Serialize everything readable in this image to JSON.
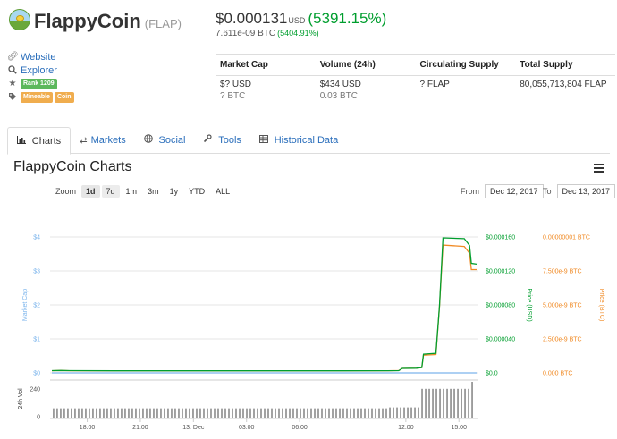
{
  "coin": {
    "name": "FlappyCoin",
    "symbol": "(FLAP)",
    "logo_icon": "flappy-bird-logo-icon"
  },
  "price": {
    "usd": "$0.000131",
    "usd_unit": "USD",
    "usd_change": "(5391.15%)",
    "btc": "7.611e-09 BTC",
    "btc_change": "(5404.91%)"
  },
  "links": {
    "website": "Website",
    "explorer": "Explorer",
    "rank": "Rank 1209",
    "tag_mineable": "Mineable",
    "tag_coin": "Coin"
  },
  "stats": {
    "headers": [
      "Market Cap",
      "Volume (24h)",
      "Circulating Supply",
      "Total Supply"
    ],
    "usd_row": [
      "$? USD",
      "$434 USD",
      "? FLAP",
      "80,055,713,804 FLAP"
    ],
    "btc_row": [
      "? BTC",
      "0.03 BTC",
      "",
      ""
    ]
  },
  "tabs": [
    {
      "label": "Charts",
      "icon": "bar-chart-icon"
    },
    {
      "label": "Markets",
      "icon": "exchange-icon"
    },
    {
      "label": "Social",
      "icon": "globe-icon"
    },
    {
      "label": "Tools",
      "icon": "wrench-icon"
    },
    {
      "label": "Historical Data",
      "icon": "table-icon"
    }
  ],
  "chart_header": {
    "title": "FlappyCoin Charts",
    "zoom_label": "Zoom",
    "zoom_buttons": [
      "1d",
      "7d",
      "1m",
      "3m",
      "1y",
      "YTD",
      "ALL"
    ],
    "selected_zoom": "1d",
    "from_label": "From",
    "from_date": "Dec 12, 2017",
    "to_label": "To",
    "to_date": "Dec 13, 2017"
  },
  "chart_data": {
    "type": "line",
    "colors": {
      "market_cap": "#7cb5ec",
      "price_usd": "#009e2e",
      "price_btc": "#f08a24",
      "volume": "#444444"
    },
    "x_ticks": [
      "18:00",
      "21:00",
      "13. Dec",
      "03:00",
      "06:00",
      "12:00",
      "15:00"
    ],
    "x_tick_hours": [
      18,
      21,
      24,
      27,
      30,
      36,
      39
    ],
    "x_range_hours": [
      15.9,
      40.1
    ],
    "market_cap_axis": {
      "label": "Market Cap",
      "ticks": [
        "$0",
        "$1",
        "$2",
        "$3",
        "$4"
      ],
      "range": [
        0,
        4
      ]
    },
    "price_usd_axis": {
      "label": "Price (USD)",
      "ticks": [
        "$0.0",
        "$0.000040",
        "$0.000080",
        "$0.000120",
        "$0.000160"
      ],
      "range": [
        0,
        0.00016
      ]
    },
    "price_btc_axis": {
      "label": "Price (BTC)",
      "ticks": [
        "0.000 BTC",
        "2.500e-9 BTC",
        "5.000e-9 BTC",
        "7.500e-9 BTC",
        "0.00000001 BTC"
      ],
      "range": [
        0,
        1e-08
      ]
    },
    "volume_axis": {
      "label": "24h Vol",
      "ticks": [
        "0",
        "240"
      ],
      "range": [
        0,
        300
      ]
    },
    "series": [
      {
        "name": "Price (USD)",
        "x": [
          16,
          16.5,
          17,
          20,
          24,
          28,
          32,
          35,
          35.6,
          35.8,
          36.6,
          36.9,
          37.0,
          37.7,
          37.9,
          38.1,
          39.3,
          39.6,
          39.7,
          40
        ],
        "values": [
          2.6e-06,
          2.8e-06,
          2.6e-06,
          2.4e-06,
          2.4e-06,
          2.4e-06,
          2.4e-06,
          2.5e-06,
          2.6e-06,
          5.3e-06,
          5.5e-06,
          6.3e-06,
          2.2e-05,
          2.3e-05,
          7.9e-05,
          0.000159,
          0.000158,
          0.00015,
          0.000129,
          0.000128
        ]
      },
      {
        "name": "Price (BTC)",
        "x": [
          16,
          16.5,
          17,
          20,
          24,
          28,
          32,
          35,
          35.6,
          35.8,
          36.6,
          36.9,
          37.0,
          37.7,
          37.9,
          38.1,
          39.3,
          39.6,
          39.7,
          40
        ],
        "values": [
          1.6e-10,
          1.8e-10,
          1.6e-10,
          1.5e-10,
          1.5e-10,
          1.5e-10,
          1.5e-10,
          1.6e-10,
          1.7e-10,
          3.3e-10,
          3.4e-10,
          3.9e-10,
          1.3e-09,
          1.35e-09,
          4.9e-09,
          9.4e-09,
          9.3e-09,
          8.8e-09,
          7.6e-09,
          7.6e-09
        ]
      },
      {
        "name": "Market Cap",
        "x": [
          16,
          40
        ],
        "values": [
          0,
          0
        ]
      }
    ],
    "volume": {
      "x_start": 16.1,
      "x_end": 39.95,
      "bar_count": 118,
      "segments": [
        {
          "from": 16.1,
          "to": 35.0,
          "value": 72
        },
        {
          "from": 35.0,
          "to": 36.9,
          "value": 80
        },
        {
          "from": 36.9,
          "to": 39.6,
          "value": 240
        },
        {
          "from": 39.6,
          "to": 39.95,
          "value": 300
        }
      ]
    }
  }
}
